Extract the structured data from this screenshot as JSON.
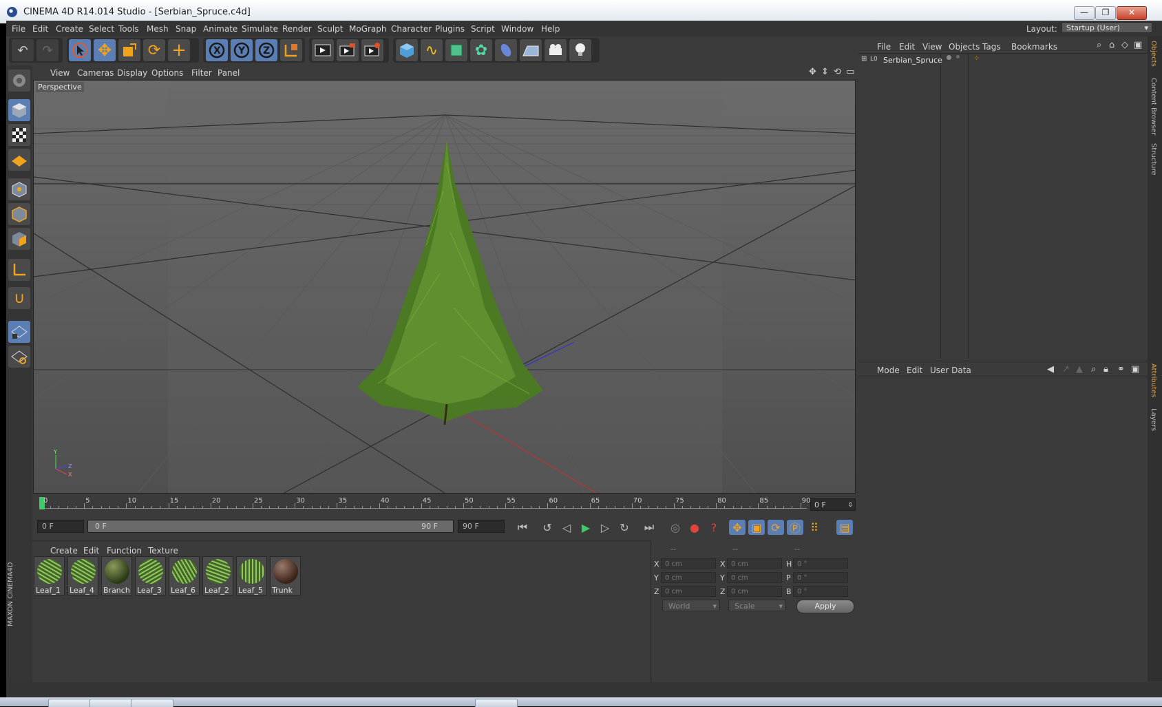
{
  "window": {
    "title": "CINEMA 4D R14.014 Studio - [Serbian_Spruce.c4d]",
    "minimize": "—",
    "restore": "❐",
    "close": "✕"
  },
  "menubar": {
    "items": [
      "File",
      "Edit",
      "Create",
      "Select",
      "Tools",
      "Mesh",
      "Snap",
      "Animate",
      "Simulate",
      "Render",
      "Sculpt",
      "MoGraph",
      "Character",
      "Plugins",
      "Script",
      "Window",
      "Help"
    ],
    "layout_label": "Layout:",
    "layout_value": "Startup (User)"
  },
  "viewport": {
    "menus": [
      "View",
      "Cameras",
      "Display",
      "Options",
      "Filter",
      "Panel"
    ],
    "label": "Perspective",
    "axis_y": "Y",
    "axis_z": "Z",
    "axis_x": "X"
  },
  "timeline": {
    "ticks": [
      "0",
      "5",
      "10",
      "15",
      "20",
      "25",
      "30",
      "35",
      "40",
      "45",
      "50",
      "55",
      "60",
      "65",
      "70",
      "75",
      "80",
      "85",
      "90"
    ],
    "current_frame": "0 F"
  },
  "transport": {
    "start_field": "0 F",
    "range_start": "0 F",
    "range_end": "90 F",
    "end_field": "90 F"
  },
  "materials": {
    "menus": [
      "Create",
      "Edit",
      "Function",
      "Texture"
    ],
    "items": [
      "Leaf_1",
      "Leaf_4",
      "Branch",
      "Leaf_3",
      "Leaf_6",
      "Leaf_2",
      "Leaf_5",
      "Trunk"
    ]
  },
  "coords": {
    "headers": [
      "--",
      "--",
      "--"
    ],
    "rows": [
      {
        "a": "X",
        "av": "0 cm",
        "b": "X",
        "bv": "0 cm",
        "c": "H",
        "cv": "0 °"
      },
      {
        "a": "Y",
        "av": "0 cm",
        "b": "Y",
        "bv": "0 cm",
        "c": "P",
        "cv": "0 °"
      },
      {
        "a": "Z",
        "av": "0 cm",
        "b": "Z",
        "bv": "0 cm",
        "c": "B",
        "cv": "0 °"
      }
    ],
    "world": "World",
    "scale": "Scale",
    "apply": "Apply"
  },
  "objects": {
    "menus": [
      "File",
      "Edit",
      "View",
      "Objects",
      "Tags",
      "Bookmarks"
    ],
    "object_name": "Serbian_Spruce",
    "layer_badge": "L0"
  },
  "attributes": {
    "menus": [
      "Mode",
      "Edit",
      "User Data"
    ]
  },
  "dock_tabs": {
    "objects": "Objects",
    "content": "Content Browser",
    "structure": "Structure",
    "attributes": "Attributes",
    "layers": "Layers"
  },
  "branding": "MAXON CINEMA4D"
}
